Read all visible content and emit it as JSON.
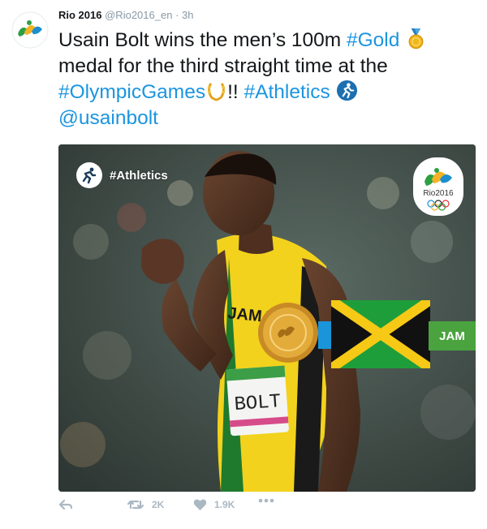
{
  "tweet": {
    "author_name": "Rio 2016",
    "author_handle": "@Rio2016_en",
    "separator": "·",
    "time": "3h",
    "text_parts": {
      "p1": "Usain Bolt wins the men’s 100m ",
      "hashtag_gold": "#Gold",
      "p2": " medal for the third straight time at the ",
      "hashtag_olympic": "#OlympicGames",
      "p3": "!! ",
      "hashtag_athletics": "#Athletics",
      "mention": "@usainbolt"
    }
  },
  "media": {
    "badge_label": "#Athletics",
    "bib_text": "BOLT",
    "jersey_text": "JAMAICA",
    "country_code": "JAM",
    "logo_text": "Rio2016"
  },
  "actions": {
    "reply_icon": "reply-icon",
    "retweet_icon": "retweet-icon",
    "retweet_count": "2K",
    "like_icon": "heart-icon",
    "like_count": "1.9K",
    "more_icon": "more-icon"
  },
  "colors": {
    "link": "#1b95e0",
    "meta": "#8899a6",
    "action": "#aab8c2",
    "jam_green": "#4aa33f",
    "jersey_yellow": "#f2d21c"
  }
}
